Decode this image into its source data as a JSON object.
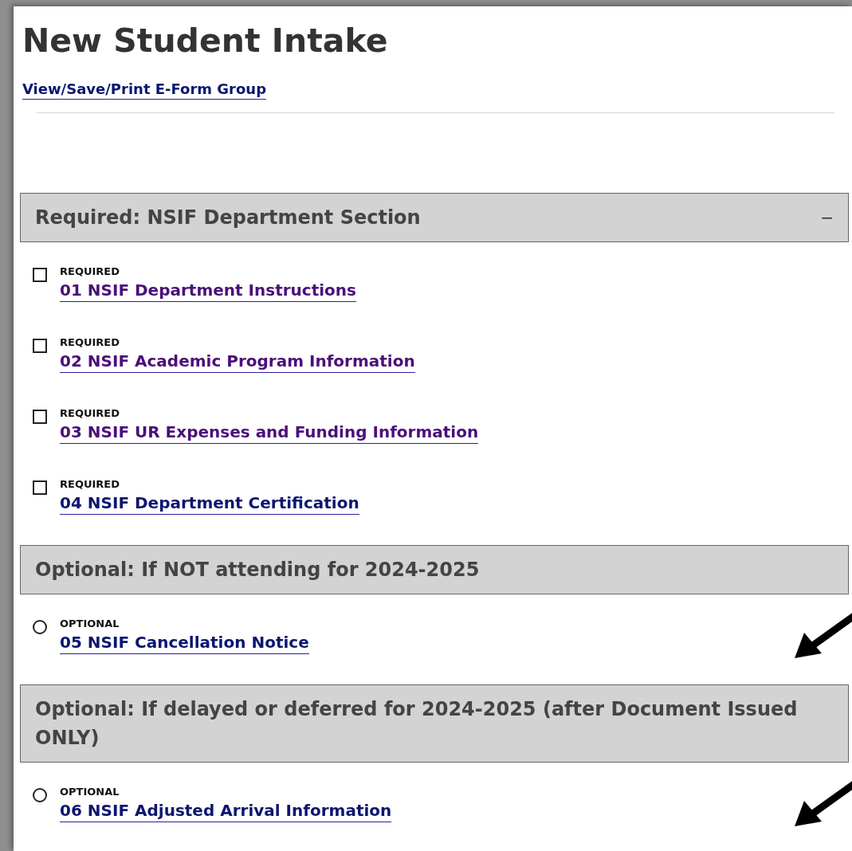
{
  "title": "New Student Intake",
  "group_link": "View/Save/Print E-Form Group",
  "sections": [
    {
      "title": "Required: NSIF Department Section",
      "toggle": "−",
      "items": [
        {
          "kind": "required",
          "badge": "REQUIRED",
          "name": "01 NSIF Department Instructions",
          "visited": true,
          "checked": false,
          "highlighted": false
        },
        {
          "kind": "required",
          "badge": "REQUIRED",
          "name": "02 NSIF Academic Program Information",
          "visited": true,
          "checked": false,
          "highlighted": false
        },
        {
          "kind": "required",
          "badge": "REQUIRED",
          "name": "03 NSIF UR Expenses and Funding Information",
          "visited": true,
          "checked": false,
          "highlighted": false
        },
        {
          "kind": "required",
          "badge": "REQUIRED",
          "name": "04 NSIF Department Certification",
          "visited": false,
          "checked": false,
          "highlighted": false
        }
      ]
    },
    {
      "title": "Optional: If NOT attending for 2024-2025",
      "items": [
        {
          "kind": "optional",
          "badge": "OPTIONAL",
          "name": "05 NSIF Cancellation Notice",
          "visited": false,
          "checked": false,
          "highlighted": true
        }
      ]
    },
    {
      "title": "Optional: If delayed or deferred for 2024-2025 (after Document Issued ONLY)",
      "items": [
        {
          "kind": "optional",
          "badge": "OPTIONAL",
          "name": "06 NSIF Adjusted Arrival Information",
          "visited": false,
          "checked": false,
          "highlighted": true
        }
      ]
    }
  ]
}
